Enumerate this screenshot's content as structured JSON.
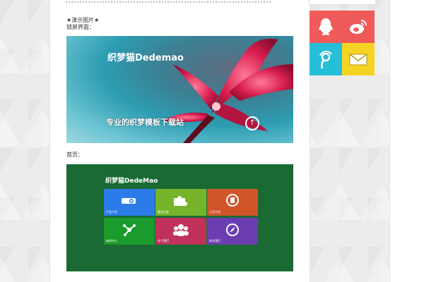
{
  "article": {
    "demo_heading": "★演示图片★",
    "lock_caption": "锁屏界面：",
    "home_caption": "首页："
  },
  "lock_screen": {
    "title": "织梦猫Dedemao",
    "slogan": "专业的织梦模板下载站"
  },
  "home_screen": {
    "title": "织梦猫DedeMao",
    "tiles": [
      {
        "label": "产品介绍",
        "color": "#2b7ce8",
        "icon": "projector-icon"
      },
      {
        "label": "解决方案",
        "color": "#76b52b",
        "icon": "puzzle-icon"
      },
      {
        "label": "公司介绍",
        "color": "#d2552a",
        "icon": "building-icon"
      },
      {
        "label": "新闻中心",
        "color": "#1b9b2b",
        "icon": "network-icon"
      },
      {
        "label": "关于我们",
        "color": "#c0325b",
        "icon": "people-icon"
      },
      {
        "label": "联系我们",
        "color": "#6a3eb1",
        "icon": "compass-icon"
      }
    ]
  },
  "share": [
    {
      "name": "qq",
      "color": "#f15a5a",
      "icon": "qq-penguin-icon"
    },
    {
      "name": "weibo",
      "color": "#ee5a5a",
      "icon": "weibo-icon"
    },
    {
      "name": "tencent-weibo",
      "color": "#26bfd8",
      "icon": "tencent-weibo-icon"
    },
    {
      "name": "email",
      "color": "#f5d322",
      "icon": "mail-icon"
    }
  ]
}
